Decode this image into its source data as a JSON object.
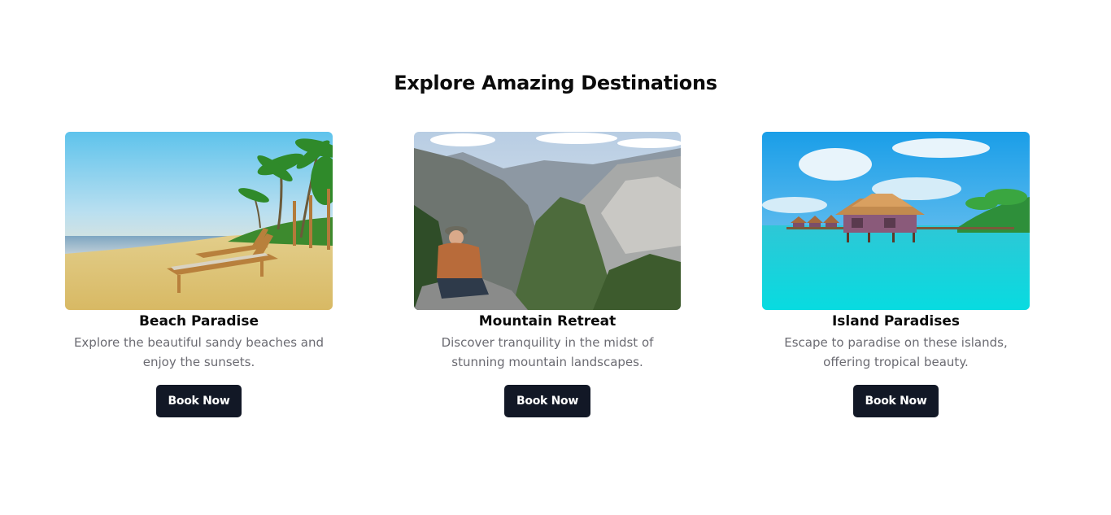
{
  "section": {
    "title": "Explore Amazing Destinations"
  },
  "cards": [
    {
      "title": "Beach Paradise",
      "description": "Explore the beautiful sandy beaches and enjoy the sunsets.",
      "button_label": "Book Now",
      "image": "beach-with-palm-trees-and-loungers"
    },
    {
      "title": "Mountain Retreat",
      "description": "Discover tranquility in the midst of stunning mountain landscapes.",
      "button_label": "Book Now",
      "image": "hiker-overlooking-mountain-valley"
    },
    {
      "title": "Island Paradises",
      "description": "Escape to paradise on these islands, offering tropical beauty.",
      "button_label": "Book Now",
      "image": "overwater-bungalows-turquoise-lagoon"
    }
  ],
  "colors": {
    "button_bg": "#121826",
    "button_text": "#ffffff",
    "description_text": "#6b6b72",
    "heading_text": "#0b0b0b"
  }
}
